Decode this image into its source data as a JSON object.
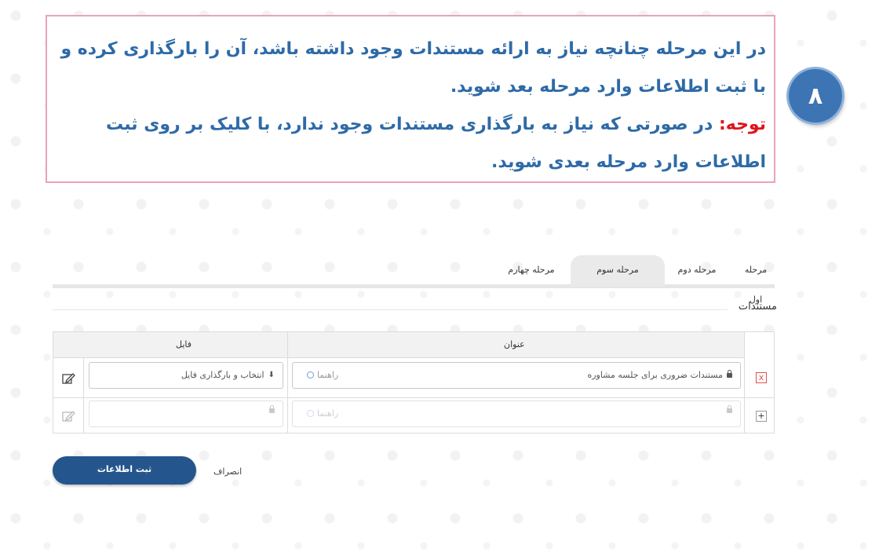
{
  "instructions": {
    "step_number": "۸",
    "line1": "در این مرحله چنانچه نیاز به ارائه مستندات وجود داشته باشد، آن را بارگذاری کرده و با ثبت اطلاعات وارد مرحله بعد شوید.",
    "note_label": "توجه:",
    "note_text": " در صورتی که نیاز به بارگذاری مستندات وجود ندارد، با کلیک بر روی ثبت اطلاعات وارد مرحله بعدی شوید."
  },
  "tabs": [
    "مرحله اول",
    "مرحله دوم",
    "مرحله سوم",
    "مرحله چهارم"
  ],
  "active_tab": "مرحله سوم",
  "section_title": "مستندات",
  "table": {
    "headers": {
      "title": "عنوان",
      "file": "فایل"
    },
    "rows": [
      {
        "title_value": "مستندات ضروری برای جلسه مشاوره",
        "hint": "راهنما",
        "file_label": "انتخاب و بارگذاری فایل",
        "row_action": "x"
      },
      {
        "title_value": "",
        "hint": "راهنما",
        "file_label": "",
        "row_action": "+"
      }
    ]
  },
  "actions": {
    "submit": "ثبت اطلاعات",
    "cancel": "انصراف"
  },
  "colors": {
    "accent": "#24568d",
    "callout_border": "#e9a3bd",
    "note": "#e0141a",
    "text_blue": "#2e6aa7"
  }
}
